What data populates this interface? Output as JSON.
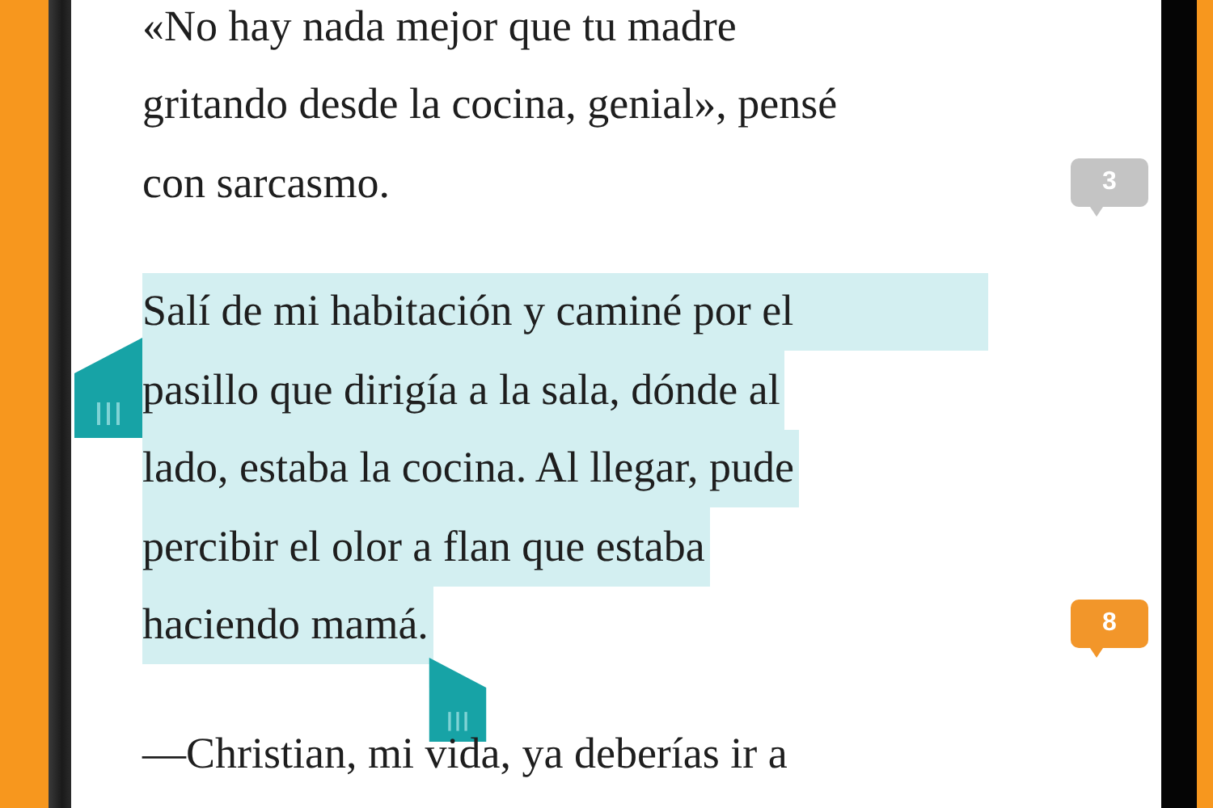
{
  "paragraphs": [
    {
      "lines": [
        "«No hay nada mejor que tu madre",
        "gritando desde la cocina, genial», pensé",
        "con sarcasmo."
      ],
      "selected": false,
      "comments": {
        "count": "3",
        "color": "#c4c4c4"
      }
    },
    {
      "lines": [
        "Salí de mi habitación y caminé por el",
        "pasillo que dirigía a la sala, dónde al",
        "lado, estaba la cocina. Al llegar, pude",
        "percibir el olor a flan que estaba",
        "haciendo mamá."
      ],
      "selected": true,
      "comments": {
        "count": "8",
        "color": "#f2962a"
      }
    },
    {
      "lines": [
        "—Christian, mi vida, ya deberías ir a"
      ],
      "selected": false
    }
  ]
}
